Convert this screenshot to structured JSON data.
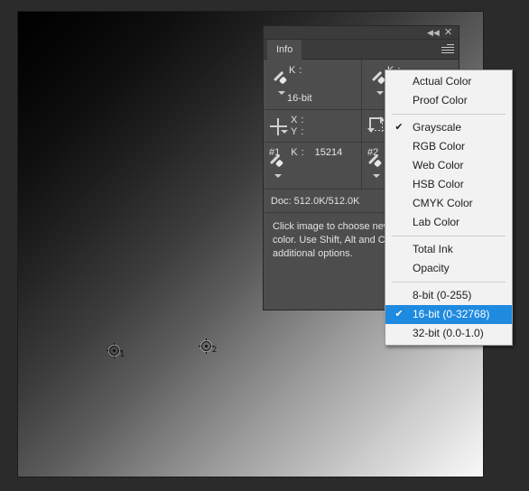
{
  "app": {
    "background_color": "#2b2b2b",
    "canvas": {
      "name": "gradient-document",
      "gradient_from": "#000000",
      "gradient_to": "#f7f7f7",
      "direction": "top-left to bottom-right"
    }
  },
  "samplers": [
    {
      "label": "1",
      "name": "color-sampler-1"
    },
    {
      "label": "2",
      "name": "color-sampler-2"
    }
  ],
  "info_panel": {
    "title": "Info",
    "titlebar": {
      "collapse_icon": "collapse-icon",
      "close_icon": "close-icon",
      "close_glyph": "✕",
      "collapse_glyph": "◀◀"
    },
    "menu_icon": "panel-menu-icon",
    "readouts": [
      {
        "channel": "K",
        "separator": ":",
        "value": "",
        "depth_note": "16-bit",
        "icon": "eyedropper-icon"
      },
      {
        "channel": "K",
        "separator": ":",
        "value": "",
        "depth_note": "",
        "icon": "eyedropper-icon"
      }
    ],
    "coords": {
      "x_label": "X",
      "y_label": "Y",
      "separator": ":",
      "x_value": "",
      "y_value": "",
      "pointer_icon": "crosshair-icon",
      "marquee_icon": "marquee-size-icon",
      "w_value": "",
      "h_value": ""
    },
    "samples": [
      {
        "index": "#1",
        "channel": "K",
        "separator": ":",
        "value": "15214",
        "icon": "eyedropper-icon"
      },
      {
        "index": "#2",
        "channel": "",
        "separator": "",
        "value": "",
        "icon": "eyedropper-icon"
      }
    ],
    "doc_status": "Doc: 512.0K/512.0K",
    "hint_lines": [
      "Click image to choose new",
      "color.  Use Shift, Alt and Ct",
      "additional options."
    ]
  },
  "context_menu": {
    "highlight_color": "#1e8ae0",
    "check_glyph": "✔",
    "groups": [
      {
        "items": [
          {
            "label": "Actual Color",
            "checked": false,
            "selected": false
          },
          {
            "label": "Proof Color",
            "checked": false,
            "selected": false
          }
        ]
      },
      {
        "items": [
          {
            "label": "Grayscale",
            "checked": true,
            "selected": false
          },
          {
            "label": "RGB Color",
            "checked": false,
            "selected": false
          },
          {
            "label": "Web Color",
            "checked": false,
            "selected": false
          },
          {
            "label": "HSB Color",
            "checked": false,
            "selected": false
          },
          {
            "label": "CMYK Color",
            "checked": false,
            "selected": false
          },
          {
            "label": "Lab Color",
            "checked": false,
            "selected": false
          }
        ]
      },
      {
        "items": [
          {
            "label": "Total Ink",
            "checked": false,
            "selected": false
          },
          {
            "label": "Opacity",
            "checked": false,
            "selected": false
          }
        ]
      },
      {
        "items": [
          {
            "label": "8-bit (0-255)",
            "checked": false,
            "selected": false
          },
          {
            "label": "16-bit (0-32768)",
            "checked": true,
            "selected": true
          },
          {
            "label": "32-bit (0.0-1.0)",
            "checked": false,
            "selected": false
          }
        ]
      }
    ]
  }
}
